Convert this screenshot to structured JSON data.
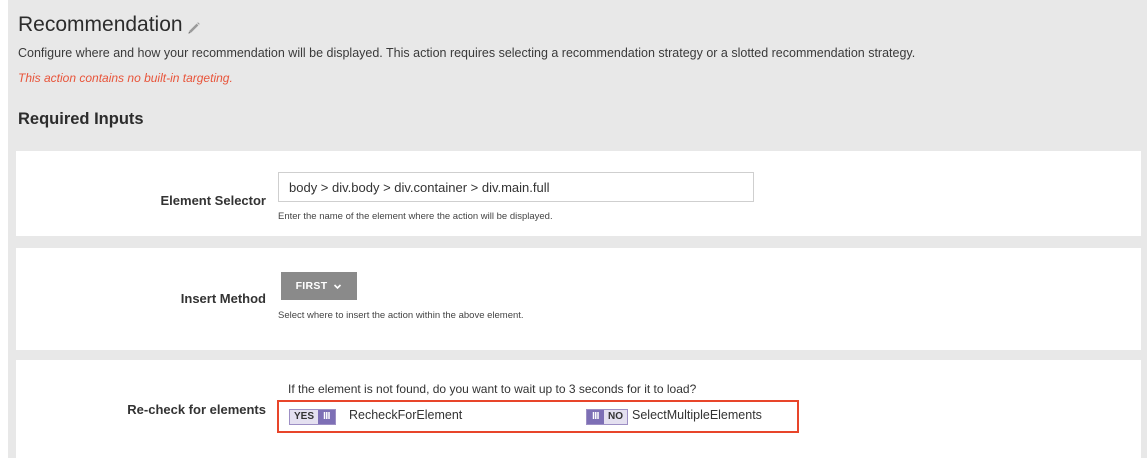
{
  "header": {
    "title": "Recommendation",
    "description": "Configure where and how your recommendation will be displayed. This action requires selecting a recommendation strategy or a slotted recommendation strategy.",
    "warning": "This action contains no built-in targeting."
  },
  "section": {
    "heading": "Required Inputs"
  },
  "element_selector": {
    "label": "Element Selector",
    "value": "body > div.body > div.container > div.main.full",
    "hint": "Enter the name of the element where the action will be displayed."
  },
  "insert_method": {
    "label": "Insert Method",
    "selected": "FIRST",
    "hint": "Select where to insert the action within the above element."
  },
  "recheck": {
    "label": "Re-check for elements",
    "question": "If the element is not found, do you want to wait up to 3 seconds for it to load?",
    "toggle1": {
      "state_text": "YES",
      "grip": "III",
      "label": "RecheckForElement"
    },
    "toggle2": {
      "state_text": "NO",
      "grip": "III",
      "label": "SelectMultipleElements"
    }
  },
  "colors": {
    "panel_bg": "#e8e8e8",
    "warning": "#e8543a",
    "toggle_accent": "#7d6fb5",
    "highlight_border": "#e8452a",
    "dropdown_bg": "#8a8a8a"
  },
  "icons": {
    "title_edit": "pencil-icon",
    "dropdown": "chevron-down-icon"
  }
}
